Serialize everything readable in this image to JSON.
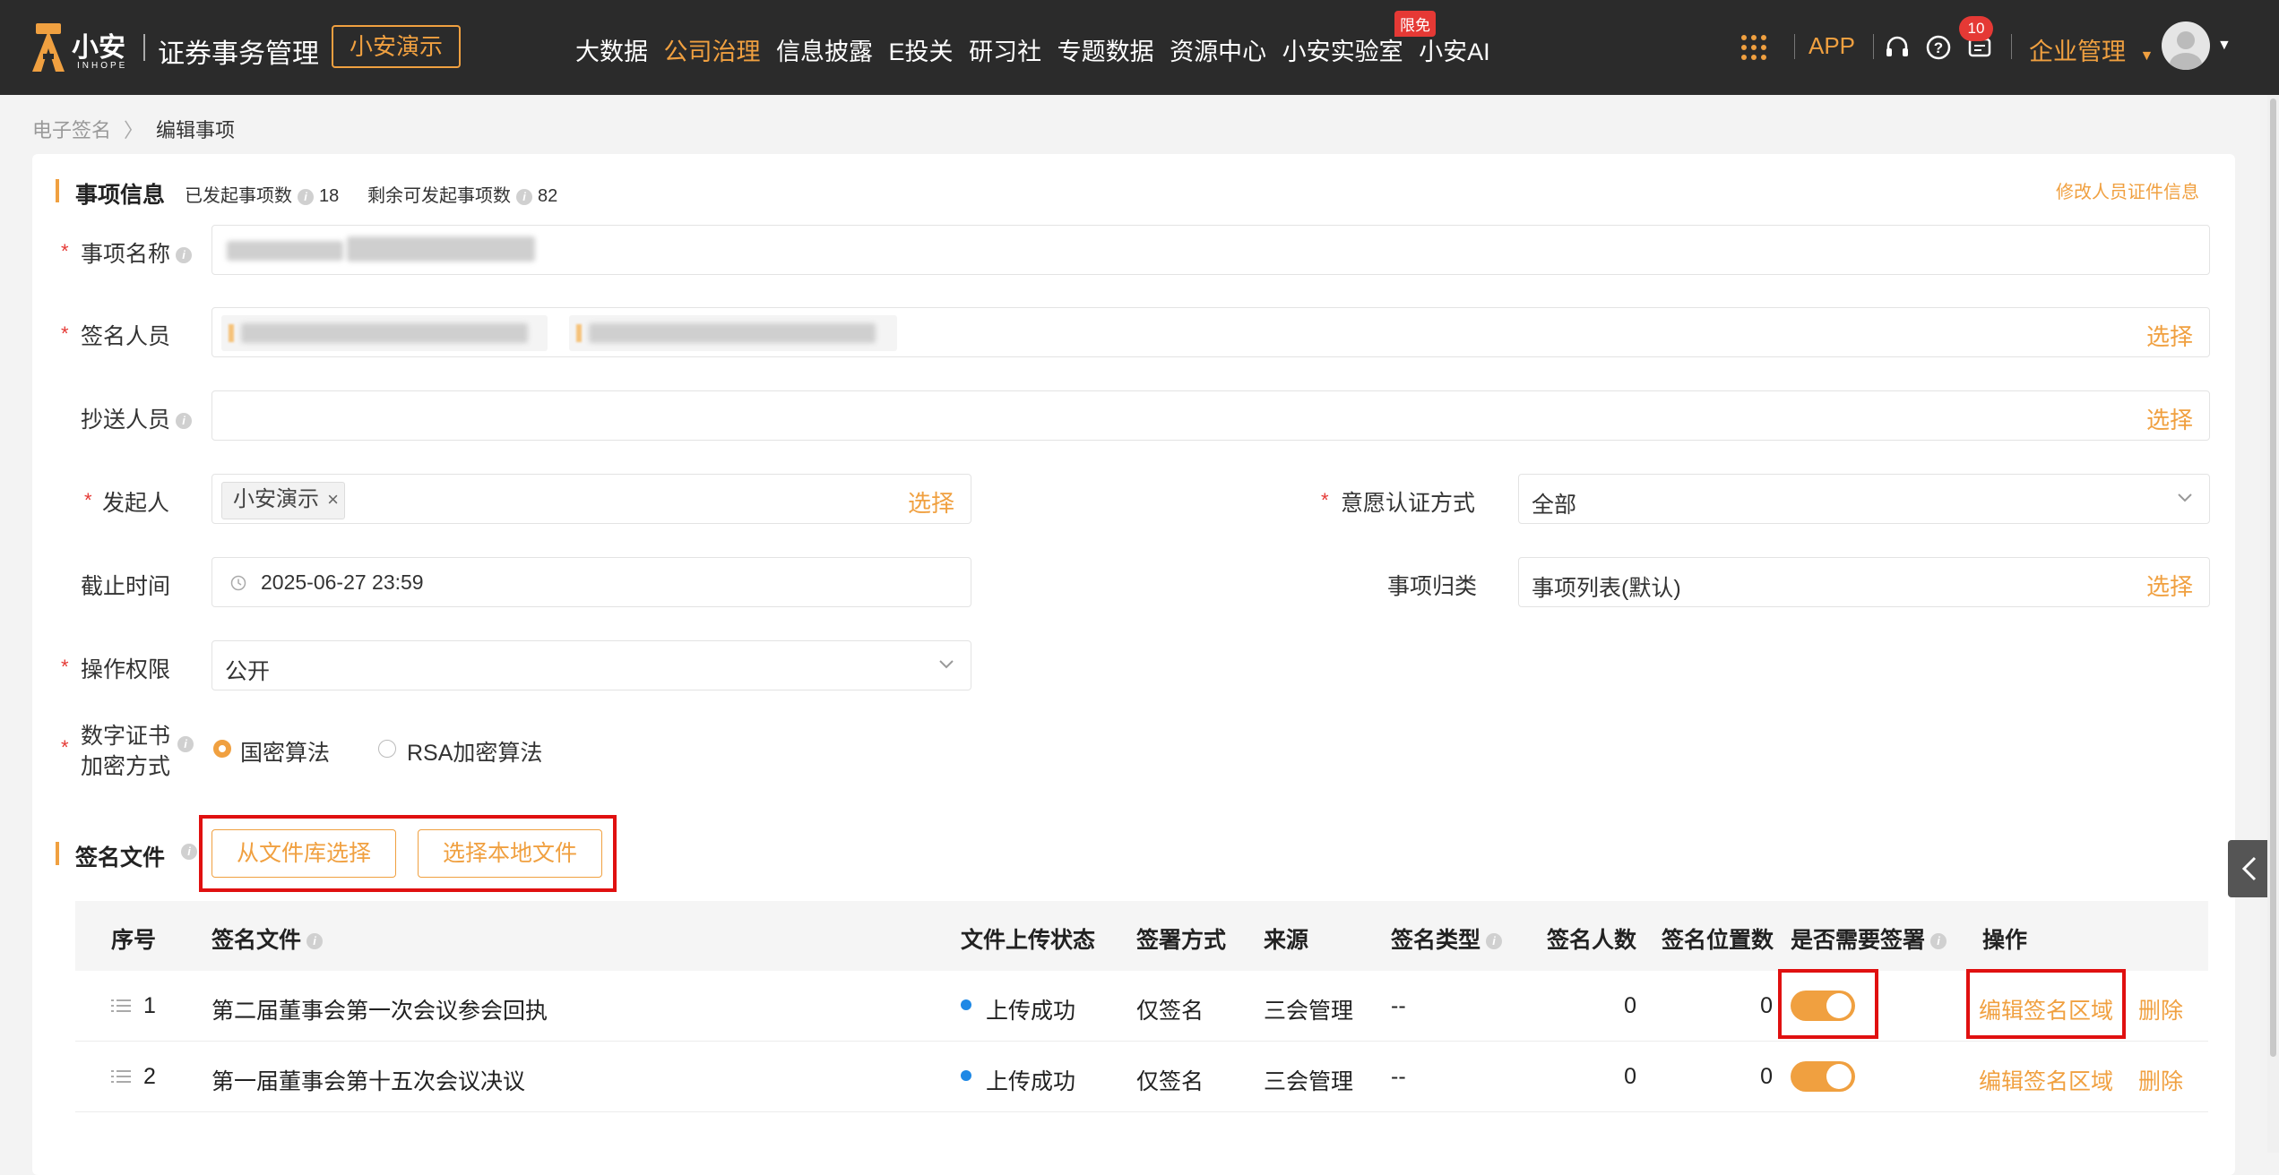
{
  "brand": {
    "name": "小安",
    "en": "INHOPE",
    "system_title": "证券事务管理",
    "tenant": "小安演示",
    "accent": "#f0a040"
  },
  "nav": {
    "items": [
      "大数据",
      "公司治理",
      "信息披露",
      "E投关",
      "研习社",
      "专题数据",
      "资源中心",
      "小安实验室",
      "小安AI"
    ],
    "active": "公司治理",
    "badge": "限免"
  },
  "header": {
    "app_label": "APP",
    "notification_count": "10",
    "org_menu": "企业管理"
  },
  "breadcrumb": {
    "parent": "电子签名",
    "current": "编辑事项"
  },
  "info_section": {
    "title": "事项信息",
    "issued_label": "已发起事项数",
    "issued_value": "18",
    "remaining_label": "剩余可发起事项数",
    "remaining_value": "82",
    "edit_link": "修改人员证件信息"
  },
  "form": {
    "name_label": "事项名称",
    "signers_label": "签名人员",
    "signers_select": "选择",
    "cc_label": "抄送人员",
    "cc_select": "选择",
    "initiator_label": "发起人",
    "initiator_tag": "小安演示",
    "initiator_select": "选择",
    "auth_label": "意愿认证方式",
    "auth_value": "全部",
    "deadline_label": "截止时间",
    "deadline_value": "2025-06-27 23:59",
    "category_label": "事项归类",
    "category_value": "事项列表(默认)",
    "category_select": "选择",
    "permission_label": "操作权限",
    "permission_value": "公开",
    "cert_label_line1": "数字证书",
    "cert_label_line2": "加密方式",
    "cert_option1": "国密算法",
    "cert_option2": "RSA加密算法"
  },
  "files_section": {
    "title": "签名文件",
    "btn_library": "从文件库选择",
    "btn_local": "选择本地文件",
    "columns": [
      "序号",
      "签名文件",
      "文件上传状态",
      "签署方式",
      "来源",
      "签名类型",
      "签名人数",
      "签名位置数",
      "是否需要签署",
      "操作"
    ],
    "rows": [
      {
        "index": "1",
        "file": "第二届董事会第一次会议参会回执",
        "status": "上传成功",
        "method": "仅签名",
        "source": "三会管理",
        "type": "--",
        "signers": "0",
        "positions": "0",
        "edit": "编辑签名区域",
        "delete": "删除"
      },
      {
        "index": "2",
        "file": "第一届董事会第十五次会议决议",
        "status": "上传成功",
        "method": "仅签名",
        "source": "三会管理",
        "type": "--",
        "signers": "0",
        "positions": "0",
        "edit": "编辑签名区域",
        "delete": "删除"
      }
    ]
  }
}
